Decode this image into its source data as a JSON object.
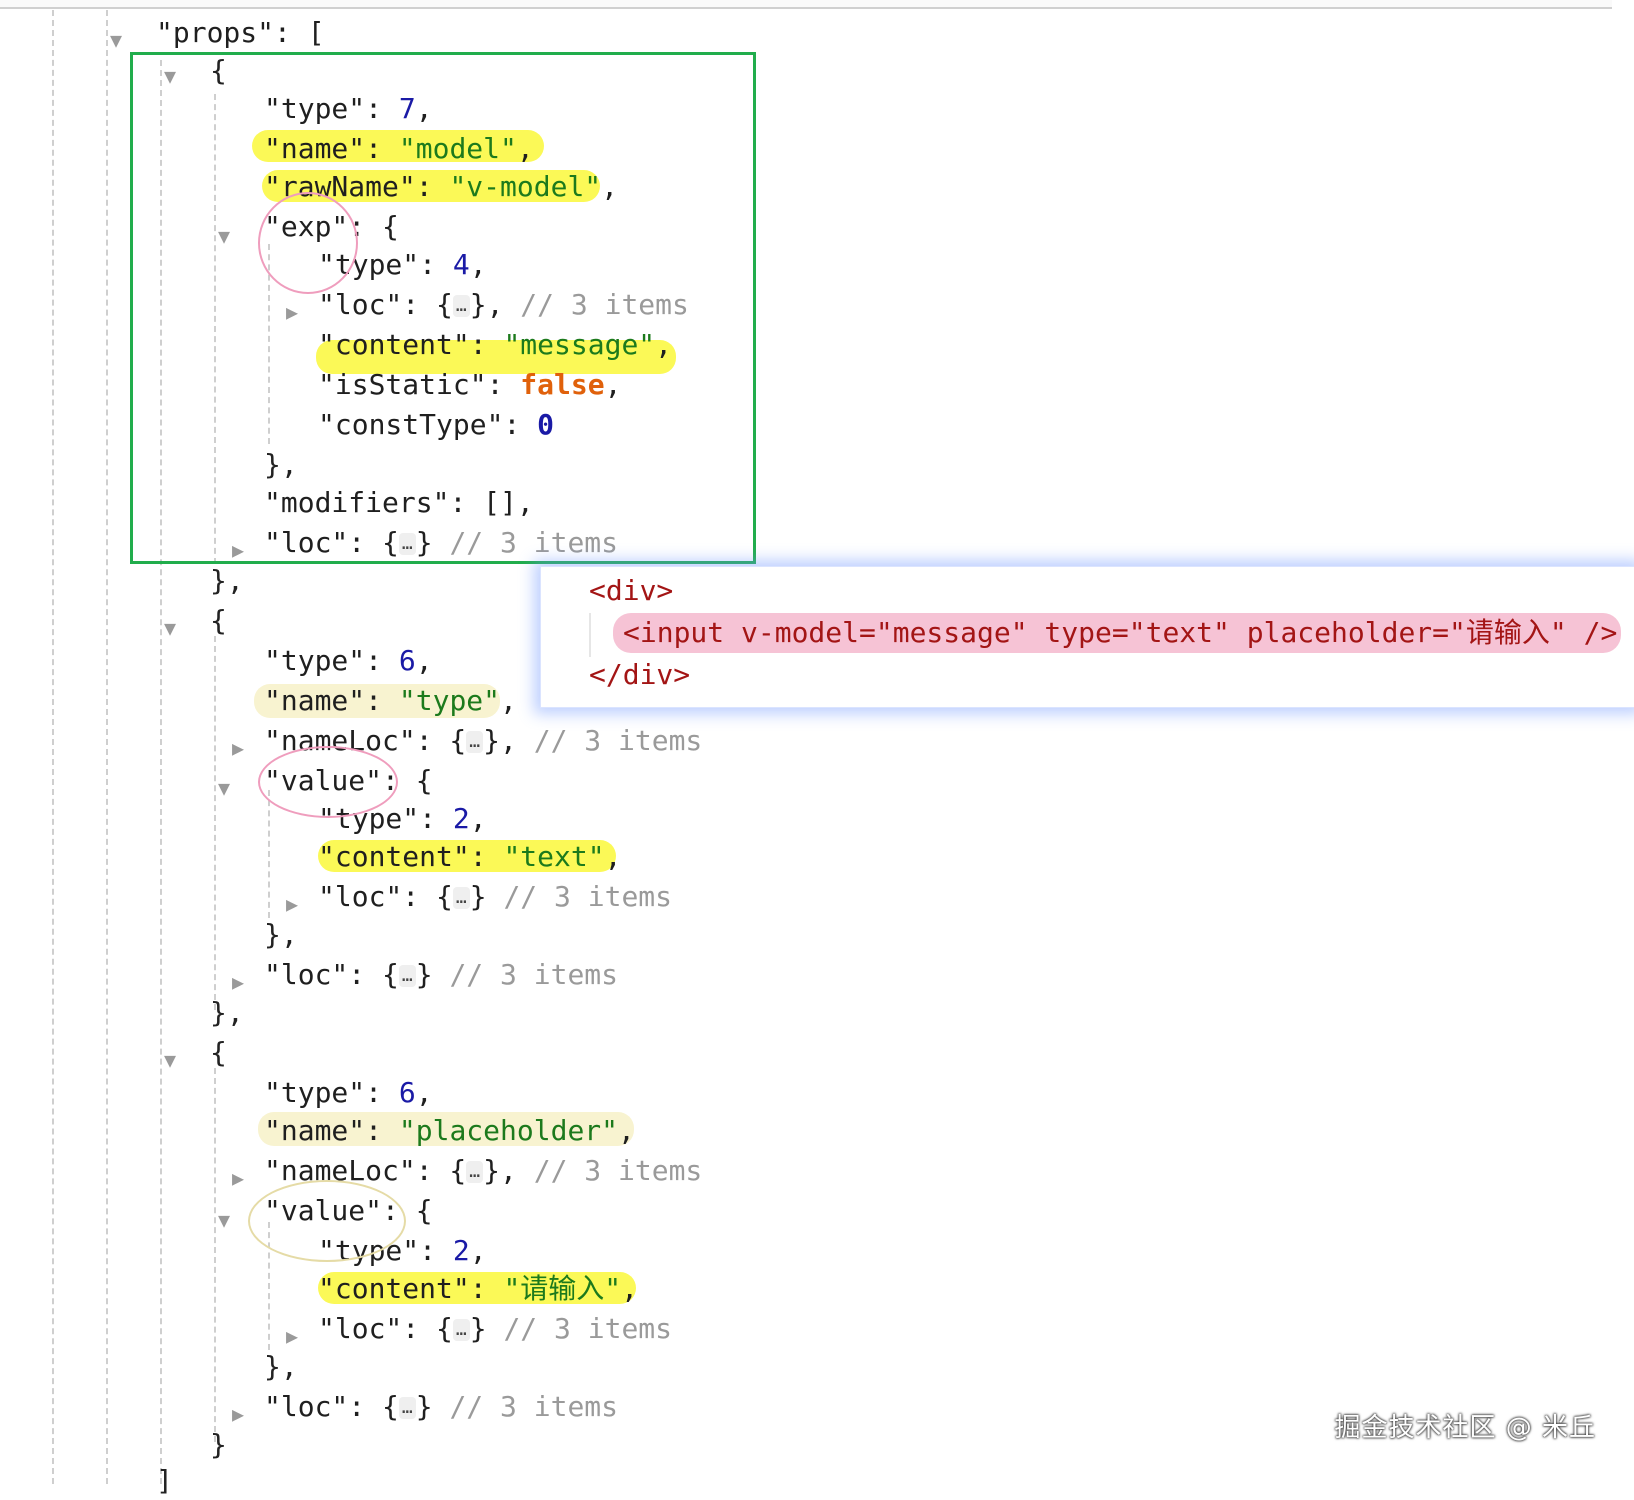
{
  "json_view": {
    "props_open": "\"props\": [",
    "prop1": {
      "open": "{",
      "type_key": "\"type\"",
      "type_val": "7",
      "name_key": "\"name\"",
      "name_val": "\"model\"",
      "rawName_key": "\"rawName\"",
      "rawName_val": "\"v-model\"",
      "exp_key": "\"exp\"",
      "exp_type_key": "\"type\"",
      "exp_type_val": "4",
      "exp_loc_key": "\"loc\"",
      "exp_loc_comment": "// 3 items",
      "exp_content_key": "\"content\"",
      "exp_content_val": "\"message\"",
      "exp_isStatic_key": "\"isStatic\"",
      "exp_isStatic_val": "false",
      "exp_constType_key": "\"constType\"",
      "exp_constType_val": "0",
      "exp_close": "},",
      "modifiers_key": "\"modifiers\"",
      "modifiers_val": "[]",
      "loc_key": "\"loc\"",
      "loc_comment": "// 3 items",
      "close": "},"
    },
    "prop2": {
      "open": "{",
      "type_key": "\"type\"",
      "type_val": "6",
      "name_key": "\"name\"",
      "name_val": "\"type\"",
      "nameLoc_key": "\"nameLoc\"",
      "nameLoc_comment": "// 3 items",
      "value_key": "\"value\"",
      "value_type_key": "\"type\"",
      "value_type_val": "2",
      "value_content_key": "\"content\"",
      "value_content_val": "\"text\"",
      "value_loc_key": "\"loc\"",
      "value_loc_comment": "// 3 items",
      "value_close": "},",
      "loc_key": "\"loc\"",
      "loc_comment": "// 3 items",
      "close": "},"
    },
    "prop3": {
      "open": "{",
      "type_key": "\"type\"",
      "type_val": "6",
      "name_key": "\"name\"",
      "name_val": "\"placeholder\"",
      "nameLoc_key": "\"nameLoc\"",
      "nameLoc_comment": "// 3 items",
      "value_key": "\"value\"",
      "value_type_key": "\"type\"",
      "value_type_val": "2",
      "value_content_key": "\"content\"",
      "value_content_val": "\"请输入\"",
      "value_loc_key": "\"loc\"",
      "value_loc_comment": "// 3 items",
      "value_close": "},",
      "loc_key": "\"loc\"",
      "loc_comment": "// 3 items",
      "close": "}"
    },
    "props_close": "]",
    "ellipsis": "…"
  },
  "code_popup": {
    "line1": "<div>",
    "line2": "<input v-model=\"message\" type=\"text\" placeholder=\"请输入\" />",
    "line3": "</div>"
  },
  "watermark": "掘金技术社区 @ 米丘",
  "colors": {
    "string": "#1c7a1c",
    "number": "#1a1aa6",
    "boolean": "#e0610b",
    "comment": "#9a9a9a",
    "highlight_yellow": "#fbf94e",
    "highlight_pink": "#f6c3d5",
    "box_green": "#21ad4c",
    "circle_pink": "#ef9dbd",
    "popup_glow": "#6e96ff",
    "tag_red": "#a31515"
  },
  "icons": {
    "expanded": "triangle-down-icon",
    "collapsed": "triangle-right-icon"
  }
}
